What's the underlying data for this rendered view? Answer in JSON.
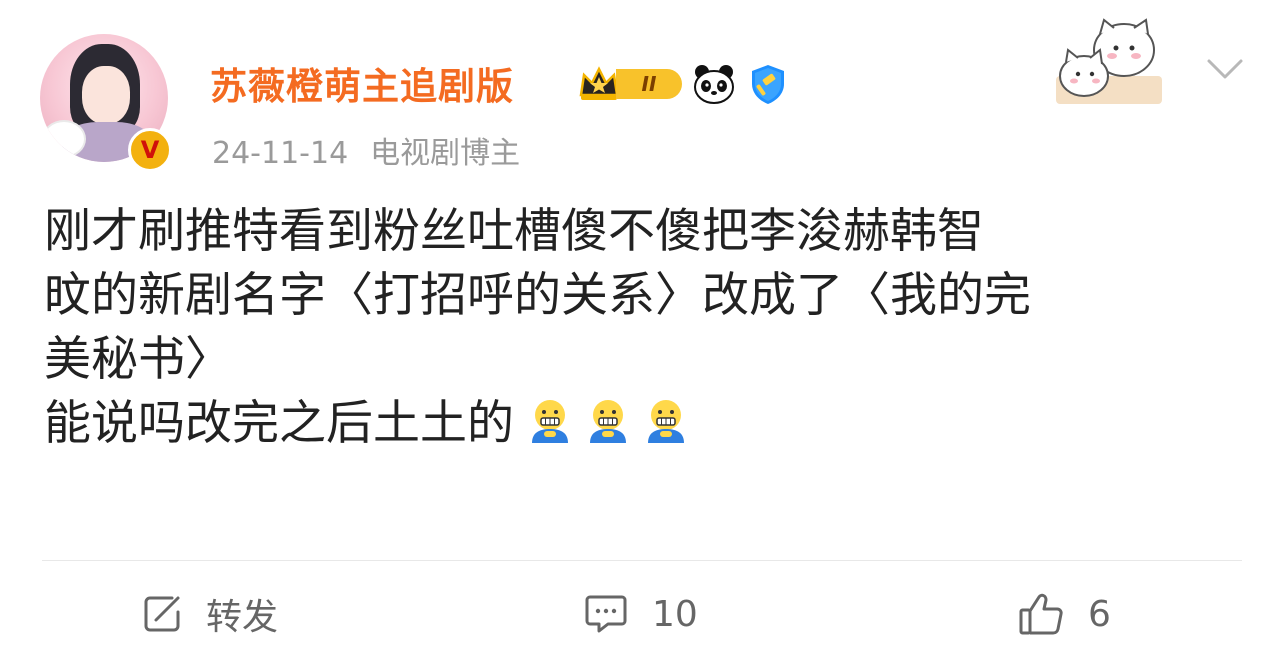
{
  "user": {
    "name": "苏薇橙萌主追剧版",
    "verified_mark": "V",
    "level_badge": "II"
  },
  "post_meta": {
    "date": "24-11-14",
    "tag": "电视剧博主"
  },
  "content": {
    "lines": [
      "刚才刷推特看到粉丝吐槽傻不傻把李浚赫韩智",
      "旼的新剧名字〈打招呼的关系〉改成了〈我的完",
      "美秘书〉",
      "能说吗改完之后土土的"
    ],
    "trailing_emojis": [
      "grimace-emoji",
      "grimace-emoji",
      "grimace-emoji"
    ]
  },
  "actions": {
    "repost_label": "转发",
    "comment_count": "10",
    "like_count": "6"
  },
  "icons": {
    "more": "chevron-down-icon",
    "repost": "share-edit-icon",
    "comment": "comment-icon",
    "like": "thumbs-up-icon"
  },
  "colors": {
    "username": "#f46b21",
    "body_text": "#222222",
    "meta_text": "#9a9a9a",
    "action_text": "#666666",
    "divider": "#e8e8e8"
  }
}
